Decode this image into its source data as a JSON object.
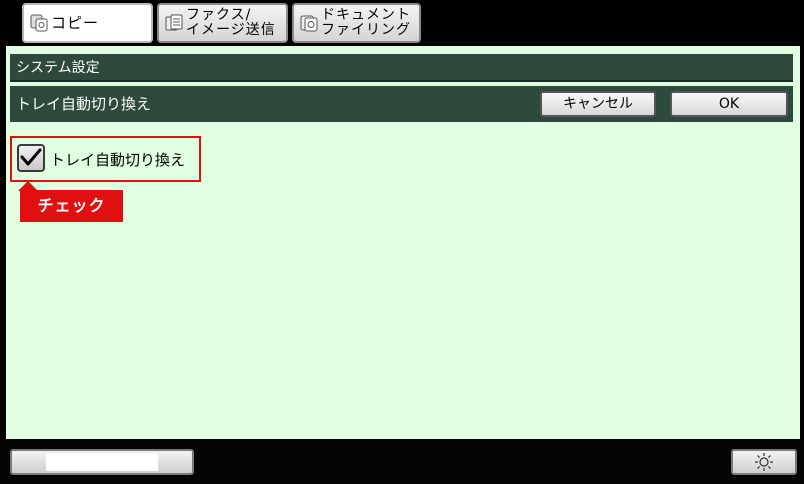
{
  "tabs": [
    {
      "label": "コピー",
      "icon": "copy-icon",
      "active": true
    },
    {
      "label": "ファクス/\nイメージ送信",
      "icon": "fax-icon",
      "active": false
    },
    {
      "label": "ドキュメント\nファイリング",
      "icon": "document-filing-icon",
      "active": false
    }
  ],
  "header": {
    "title": "システム設定"
  },
  "setting": {
    "name": "トレイ自動切り換え",
    "cancel_label": "キャンセル",
    "ok_label": "OK"
  },
  "option": {
    "label": "トレイ自動切り換え",
    "checked": true
  },
  "annotation": {
    "text": "チェック",
    "color": "#e01010"
  },
  "colors": {
    "main_bg": "#e0ffe0",
    "bar_bg": "#2e4a3d"
  },
  "bottom": {
    "brightness_icon": "sun-icon"
  }
}
